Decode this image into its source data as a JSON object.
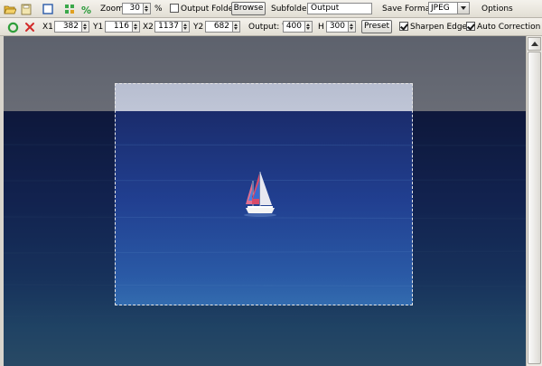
{
  "toolbar1": {
    "zoom_label": "Zoom",
    "zoom_value": "30",
    "zoom_unit": "%",
    "output_folder_label": "Output Folder",
    "output_folder_checked": false,
    "browse_label": "Browse",
    "subfolder_label": "Subfolder",
    "subfolder_value": "Output",
    "save_format_label": "Save Format",
    "save_format_value": "JPEG",
    "options_label": "Options"
  },
  "toolbar2": {
    "x1_label": "X1",
    "x1_value": "382",
    "y1_label": "Y1",
    "y1_value": "116",
    "x2_label": "X2",
    "x2_value": "1137",
    "y2_label": "Y2",
    "y2_value": "682",
    "output_label": "Output: W",
    "w_value": "400",
    "h_label": "H",
    "h_value": "300",
    "preset_label": "Preset",
    "sharpen_label": "Sharpen Edge",
    "sharpen_checked": true,
    "auto_label": "Auto Correction",
    "auto_checked": true
  },
  "colors": {
    "apply_icon": "#2f9e3a",
    "cancel_icon": "#d22a2a",
    "sky": "#aeb6c8",
    "sea_deep": "#142a66",
    "sea_mid": "#1f3f8e",
    "sea_light": "#3a78b8"
  }
}
